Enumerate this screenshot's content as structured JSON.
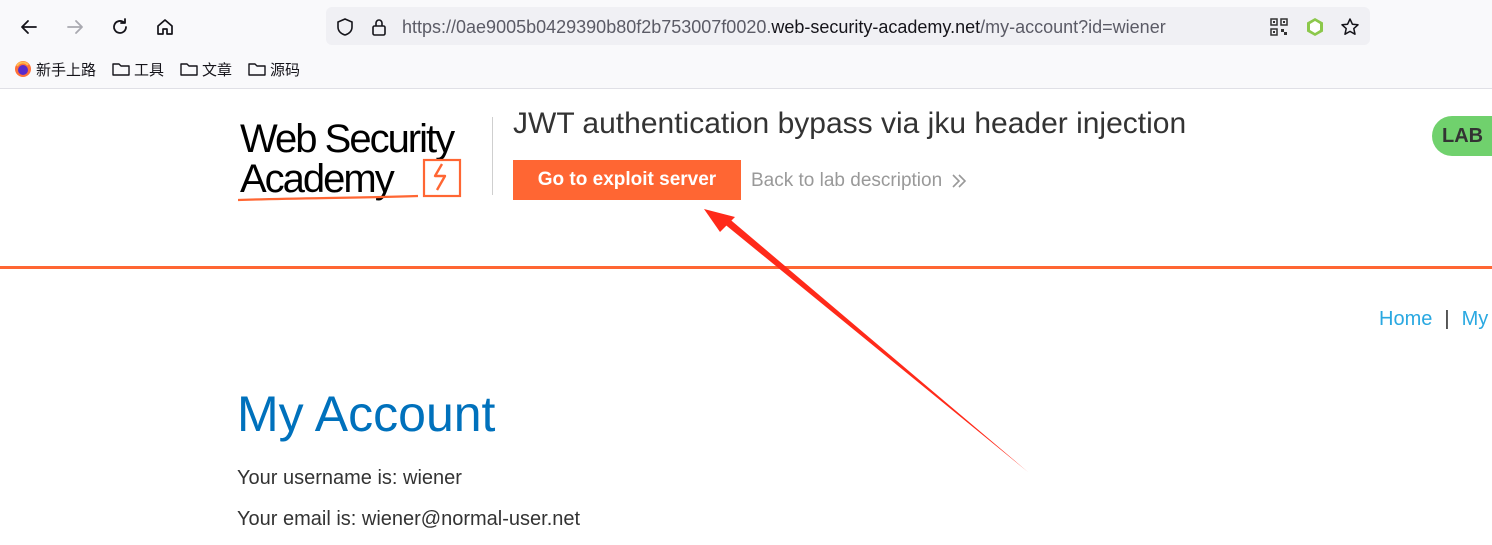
{
  "browser": {
    "url_prefix": "https://0ae9005b0429390b80f2b753007f0020.",
    "url_domain": "web-security-academy.net",
    "url_path": "/my-account?id=wiener",
    "bookmarks": [
      "新手上路",
      "工具",
      "文章",
      "源码"
    ]
  },
  "header": {
    "logo_line1": "Web Security",
    "logo_line2": "Academy",
    "lab_title": "JWT authentication bypass via jku header injection",
    "exploit_button": "Go to exploit server",
    "back_link": "Back to lab description",
    "lab_badge": "LAB"
  },
  "nav": {
    "home": "Home",
    "separator": "|",
    "my_account": "My"
  },
  "account": {
    "heading": "My Account",
    "username_line": "Your username is: wiener",
    "email_line": "Your email is: wiener@normal-user.net"
  },
  "colors": {
    "accent_orange": "#ff6633",
    "link_blue": "#29a8e1",
    "heading_blue": "#0071bc",
    "badge_green": "#70d16d",
    "annotation_red": "#ff2a1a"
  },
  "icons": [
    "back-arrow-icon",
    "forward-arrow-icon",
    "reload-icon",
    "home-icon",
    "shield-icon",
    "lock-icon",
    "qr-code-icon",
    "nodejs-extension-icon",
    "star-icon",
    "firefox-icon",
    "folder-icon",
    "double-chevron-right-icon"
  ]
}
